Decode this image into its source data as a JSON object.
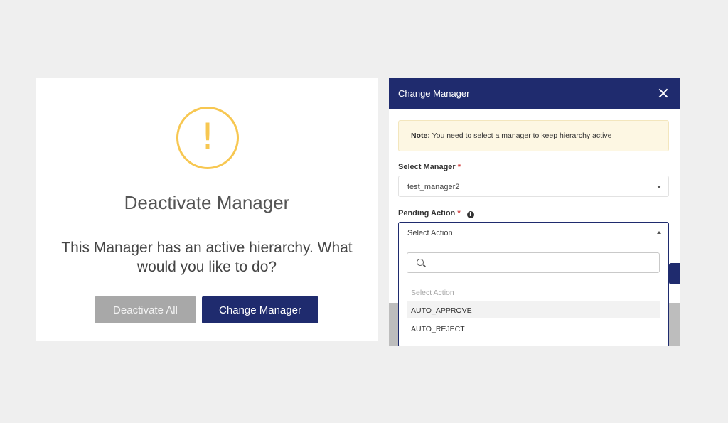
{
  "confirm_dialog": {
    "title": "Deactivate Manager",
    "message": "This Manager has an active hierarchy. What would you like to do?",
    "deactivate_all_label": "Deactivate All",
    "change_manager_label": "Change Manager",
    "icon": "warning-icon",
    "accent_color": "#f7c751"
  },
  "change_modal": {
    "title": "Change Manager",
    "note_prefix": "Note:",
    "note_text": "You need to select a manager to keep hierarchy active",
    "select_manager_label": "Select Manager",
    "select_manager_value": "test_manager2",
    "pending_action_label": "Pending Action",
    "required_mark": "*",
    "pending_action_value": "Select Action",
    "options": [
      "Select Action",
      "AUTO_APPROVE",
      "AUTO_REJECT"
    ],
    "header_color": "#1f2b6e"
  }
}
